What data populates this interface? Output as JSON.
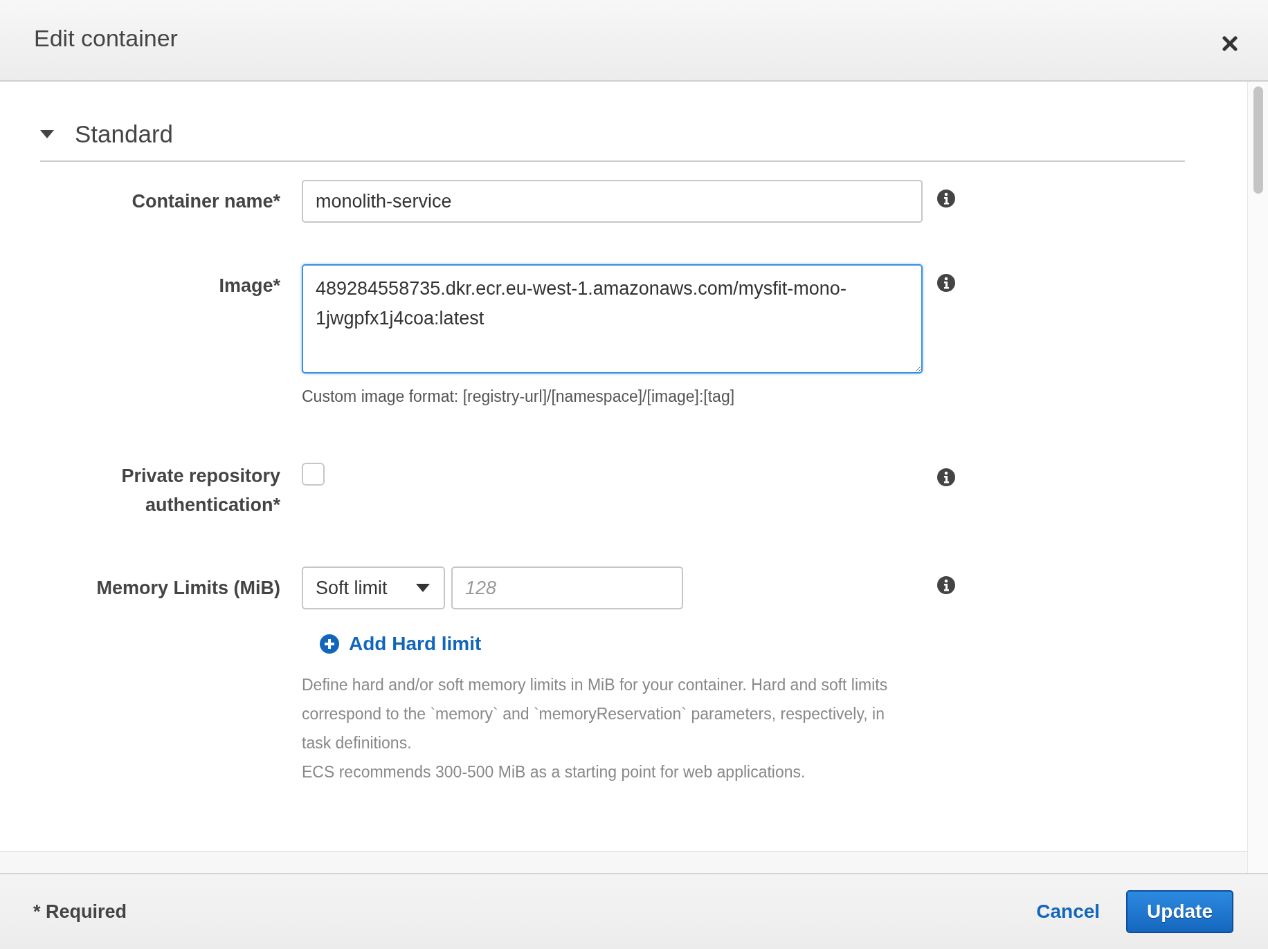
{
  "dialog": {
    "title": "Edit container"
  },
  "section": {
    "title": "Standard",
    "expanded": true
  },
  "fields": [
    {
      "kind": "text",
      "label": "Container name*",
      "value": "monolith-service",
      "focused": false
    },
    {
      "kind": "textarea",
      "label": "Image*",
      "value": "489284558735.dkr.ecr.eu-west-1.amazonaws.com/mysfit-mono-1jwgpfx1j4coa:latest",
      "focused": true,
      "help": "Custom image format: [registry-url]/[namespace]/[image]:[tag]"
    },
    {
      "kind": "checkbox",
      "label": "Private repository authentication*",
      "checked": false
    },
    {
      "kind": "memory",
      "label": "Memory Limits (MiB)",
      "select": "Soft limit",
      "placeholder": "128",
      "link": "Add Hard limit",
      "help": [
        "Define hard and/or soft memory limits in MiB for your container. Hard and soft limits correspond to the `memory` and `memoryReservation` parameters, respectively, in task definitions.",
        "ECS recommends 300-500 MiB as a starting point for web applications."
      ]
    }
  ],
  "footer": {
    "note": "* Required",
    "cancel": "Cancel",
    "submit": "Update"
  }
}
